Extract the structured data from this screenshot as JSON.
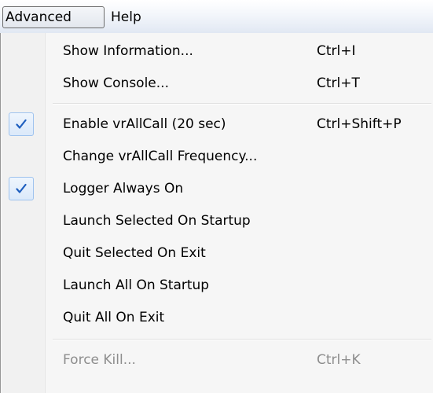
{
  "menubar": {
    "advanced_label": "Advanced",
    "help_label": "Help"
  },
  "menu": {
    "items": [
      {
        "label": "Show Information...",
        "shortcut": "Ctrl+I",
        "checked": false,
        "enabled": true
      },
      {
        "label": "Show Console...",
        "shortcut": "Ctrl+T",
        "checked": false,
        "enabled": true
      },
      {
        "label": "Enable vrAllCall (20 sec)",
        "shortcut": "Ctrl+Shift+P",
        "checked": true,
        "enabled": true
      },
      {
        "label": "Change vrAllCall Frequency...",
        "shortcut": "",
        "checked": false,
        "enabled": true
      },
      {
        "label": "Logger Always On",
        "shortcut": "",
        "checked": true,
        "enabled": true
      },
      {
        "label": "Launch Selected On Startup",
        "shortcut": "",
        "checked": false,
        "enabled": true
      },
      {
        "label": "Quit Selected On Exit",
        "shortcut": "",
        "checked": false,
        "enabled": true
      },
      {
        "label": "Launch All On Startup",
        "shortcut": "",
        "checked": false,
        "enabled": true
      },
      {
        "label": "Quit All On Exit",
        "shortcut": "",
        "checked": false,
        "enabled": true
      },
      {
        "label": "Force Kill...",
        "shortcut": "Ctrl+K",
        "checked": false,
        "enabled": false
      }
    ]
  },
  "colors": {
    "disabled_text": "#8d8d8d",
    "checkmark": "#1f5fbf",
    "check_highlight_border": "#9fc3ee"
  },
  "icons": {
    "check": "checkmark-icon"
  }
}
